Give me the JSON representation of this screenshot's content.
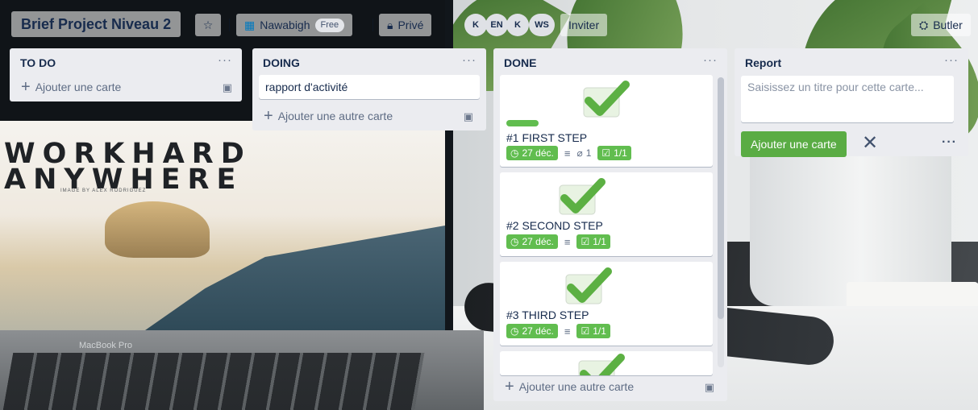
{
  "board": {
    "title": "Brief Project Niveau 2",
    "workspace": "Nawabigh",
    "workspace_plan": "Free",
    "visibility": "Privé",
    "members": [
      "K",
      "EN",
      "K",
      "WS"
    ],
    "invite_label": "Inviter",
    "butler_label": "Butler"
  },
  "background": {
    "poster_line1": "WORKHARD",
    "poster_line2": "ANYWHERE",
    "poster_credit": "IMAGE BY ALEX RODRIGUEZ",
    "laptop_label": "MacBook Pro"
  },
  "lists": [
    {
      "name": "TO DO",
      "menu": "···",
      "add_label": "Ajouter une carte"
    },
    {
      "name": "DOING",
      "menu": "···",
      "cards": [
        {
          "title": "rapport d'activité"
        }
      ],
      "add_label": "Ajouter une autre carte"
    },
    {
      "name": "DONE",
      "menu": "···",
      "cards": [
        {
          "title": "#1 FIRST STEP",
          "due": "27 déc.",
          "attachments": "1",
          "checklist": "1/1",
          "label_color": "#61bd4f"
        },
        {
          "title": "#2 SECOND STEP",
          "due": "27 déc.",
          "checklist": "1/1"
        },
        {
          "title": "#3 THIRD STEP",
          "due": "27 déc.",
          "checklist": "1/1"
        }
      ],
      "add_label": "Ajouter une autre carte"
    },
    {
      "name": "Report",
      "menu": "···",
      "composer_placeholder": "Saisissez un titre pour cette carte...",
      "add_button": "Ajouter une carte",
      "close_icon": "✕",
      "more_icon": "···"
    }
  ],
  "colors": {
    "accent_green": "#61bd4f",
    "button_green": "#5aac44",
    "list_bg": "#ebecf0"
  }
}
